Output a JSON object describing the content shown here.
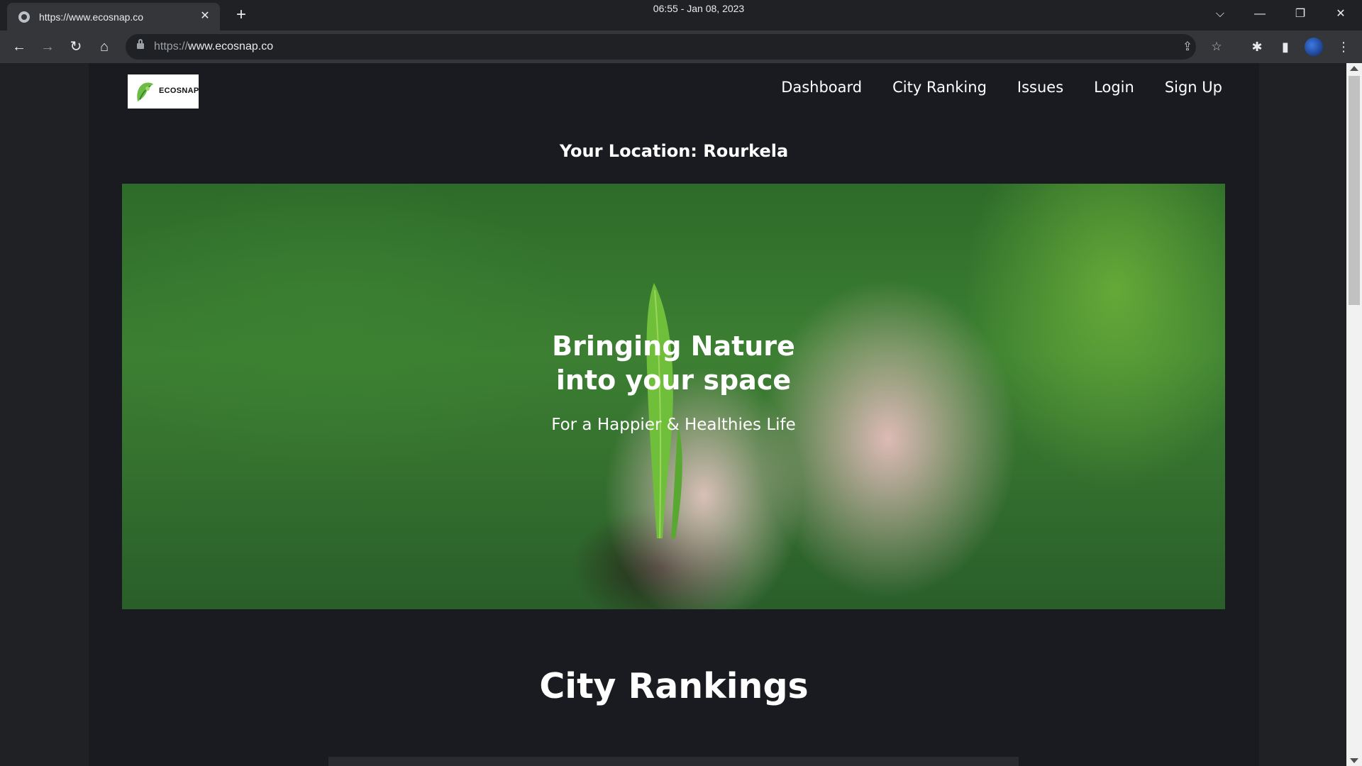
{
  "browser": {
    "tab_title": "https://www.ecosnap.co",
    "tab_close": "✕",
    "new_tab": "+",
    "clock": "06:55 - Jan 08, 2023",
    "url_scheme": "https://",
    "url_host": "www.ecosnap.co",
    "window_controls": {
      "dropdown": "⌵",
      "minimize": "—",
      "restore": "❐",
      "close": "✕"
    },
    "nav": {
      "back": "←",
      "forward": "→",
      "reload": "↻",
      "home": "⌂"
    },
    "icons": {
      "share": "⇪",
      "bookmark": "☆",
      "extensions": "✱",
      "side_panel": "▮",
      "menu": "⋮"
    }
  },
  "site": {
    "logo_text": "ECOSNAP",
    "nav": {
      "dashboard": "Dashboard",
      "city_ranking": "City Ranking",
      "issues": "Issues",
      "login": "Login",
      "signup": "Sign Up"
    },
    "location_label": "Your Location: Rourkela",
    "hero": {
      "title_line1": "Bringing Nature",
      "title_line2": "into your space",
      "subtitle": "For a Happier & Healthies Life"
    },
    "section_title": "City Rankings"
  }
}
